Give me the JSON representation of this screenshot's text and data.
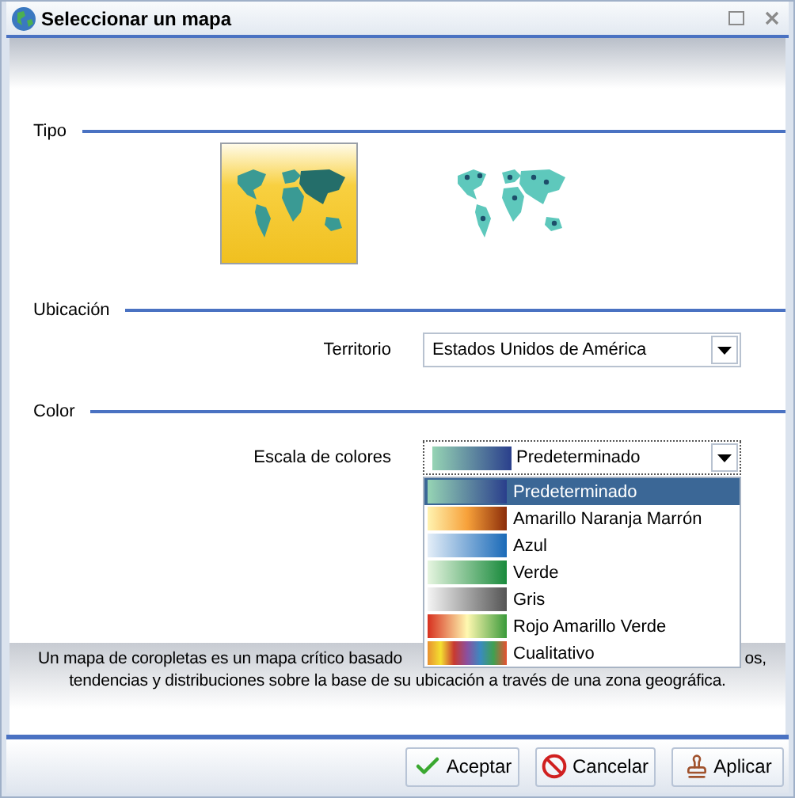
{
  "window": {
    "title": "Seleccionar un mapa"
  },
  "sections": [
    {
      "title": "Tipo"
    },
    {
      "title": "Ubicación"
    },
    {
      "title": "Color"
    }
  ],
  "map_types": [
    {
      "kind": "filled",
      "selected": true
    },
    {
      "kind": "dotted",
      "selected": false
    }
  ],
  "territory": {
    "label": "Territorio",
    "value": "Estados Unidos de América"
  },
  "color_scale": {
    "label": "Escala de colores",
    "value": "Predeterminado",
    "expanded": true,
    "options": [
      {
        "label": "Predeterminado",
        "selected": true,
        "kind": "default"
      },
      {
        "label": "Amarillo Naranja Marrón",
        "selected": false,
        "kind": "orange"
      },
      {
        "label": "Azul",
        "selected": false,
        "kind": "blue"
      },
      {
        "label": "Verde",
        "selected": false,
        "kind": "green"
      },
      {
        "label": "Gris",
        "selected": false,
        "kind": "gray"
      },
      {
        "label": "Rojo Amarillo Verde",
        "selected": false,
        "kind": "diverging"
      },
      {
        "label": "Cualitativo",
        "selected": false,
        "kind": "qualitative"
      }
    ]
  },
  "description": {
    "line_1_start": "Un mapa de coropletas es un mapa crítico basado",
    "line_1_end": "os,",
    "line_2": "tendencias y distribuciones sobre la base de su ubicación a través de una zona geográfica."
  },
  "buttons": [
    {
      "kind": "ok",
      "label": "Aceptar"
    },
    {
      "kind": "cancel",
      "label": "Cancelar"
    },
    {
      "kind": "apply",
      "label": "Aplicar"
    }
  ]
}
